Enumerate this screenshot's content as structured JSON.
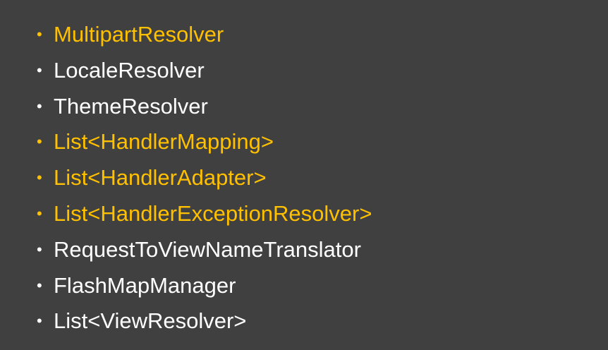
{
  "colors": {
    "background": "#404040",
    "highlight": "#FFC000",
    "normal": "#FFFFFF"
  },
  "bullet_symbol": "•",
  "items": [
    {
      "label": "MultipartResolver",
      "highlight": true
    },
    {
      "label": "LocaleResolver",
      "highlight": false
    },
    {
      "label": "ThemeResolver",
      "highlight": false
    },
    {
      "label": "List<HandlerMapping>",
      "highlight": true
    },
    {
      "label": "List<HandlerAdapter>",
      "highlight": true
    },
    {
      "label": "List<HandlerExceptionResolver>",
      "highlight": true
    },
    {
      "label": "RequestToViewNameTranslator",
      "highlight": false
    },
    {
      "label": "FlashMapManager",
      "highlight": false
    },
    {
      "label": "List<ViewResolver>",
      "highlight": false
    }
  ]
}
